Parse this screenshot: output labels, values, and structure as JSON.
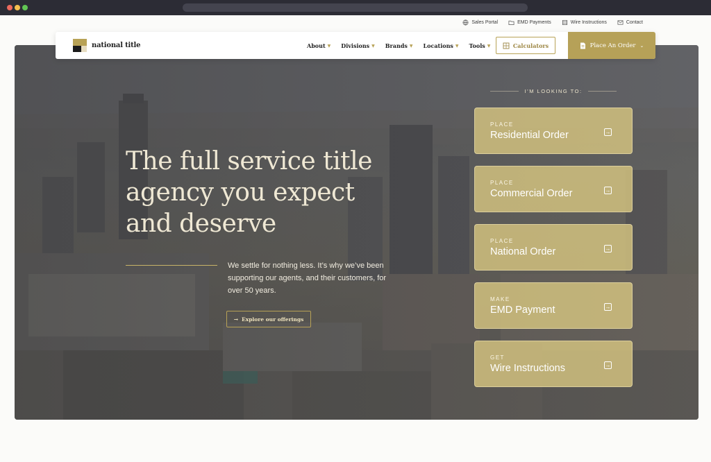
{
  "utility_links": [
    {
      "label": "Sales Portal",
      "icon": "globe-icon"
    },
    {
      "label": "EMD Payments",
      "icon": "folder-icon"
    },
    {
      "label": "Wire Instructions",
      "icon": "building-icon"
    },
    {
      "label": "Contact",
      "icon": "mail-icon"
    }
  ],
  "brand": {
    "name": "national title"
  },
  "nav": {
    "items": [
      "About",
      "Divisions",
      "Brands",
      "Locations",
      "Tools"
    ],
    "calculators_label": "Calculators",
    "order_label": "Place An Order"
  },
  "hero": {
    "headline": "The full service title agency you expect and deserve",
    "lead": "We settle for nothing less. It’s why we’ve been supporting our agents, and their customers, for over 50 years.",
    "explore_label": "Explore our offerings"
  },
  "actions": {
    "heading": "I’M LOOKING TO:",
    "cards": [
      {
        "kicker": "PLACE",
        "title": "Residential Order"
      },
      {
        "kicker": "PLACE",
        "title": "Commercial Order"
      },
      {
        "kicker": "PLACE",
        "title": "National Order"
      },
      {
        "kicker": "MAKE",
        "title": "EMD Payment"
      },
      {
        "kicker": "GET",
        "title": "Wire Instructions"
      }
    ]
  },
  "colors": {
    "accent": "#b6a158",
    "card": "#d6c480",
    "heading_text": "#efe8d4"
  }
}
